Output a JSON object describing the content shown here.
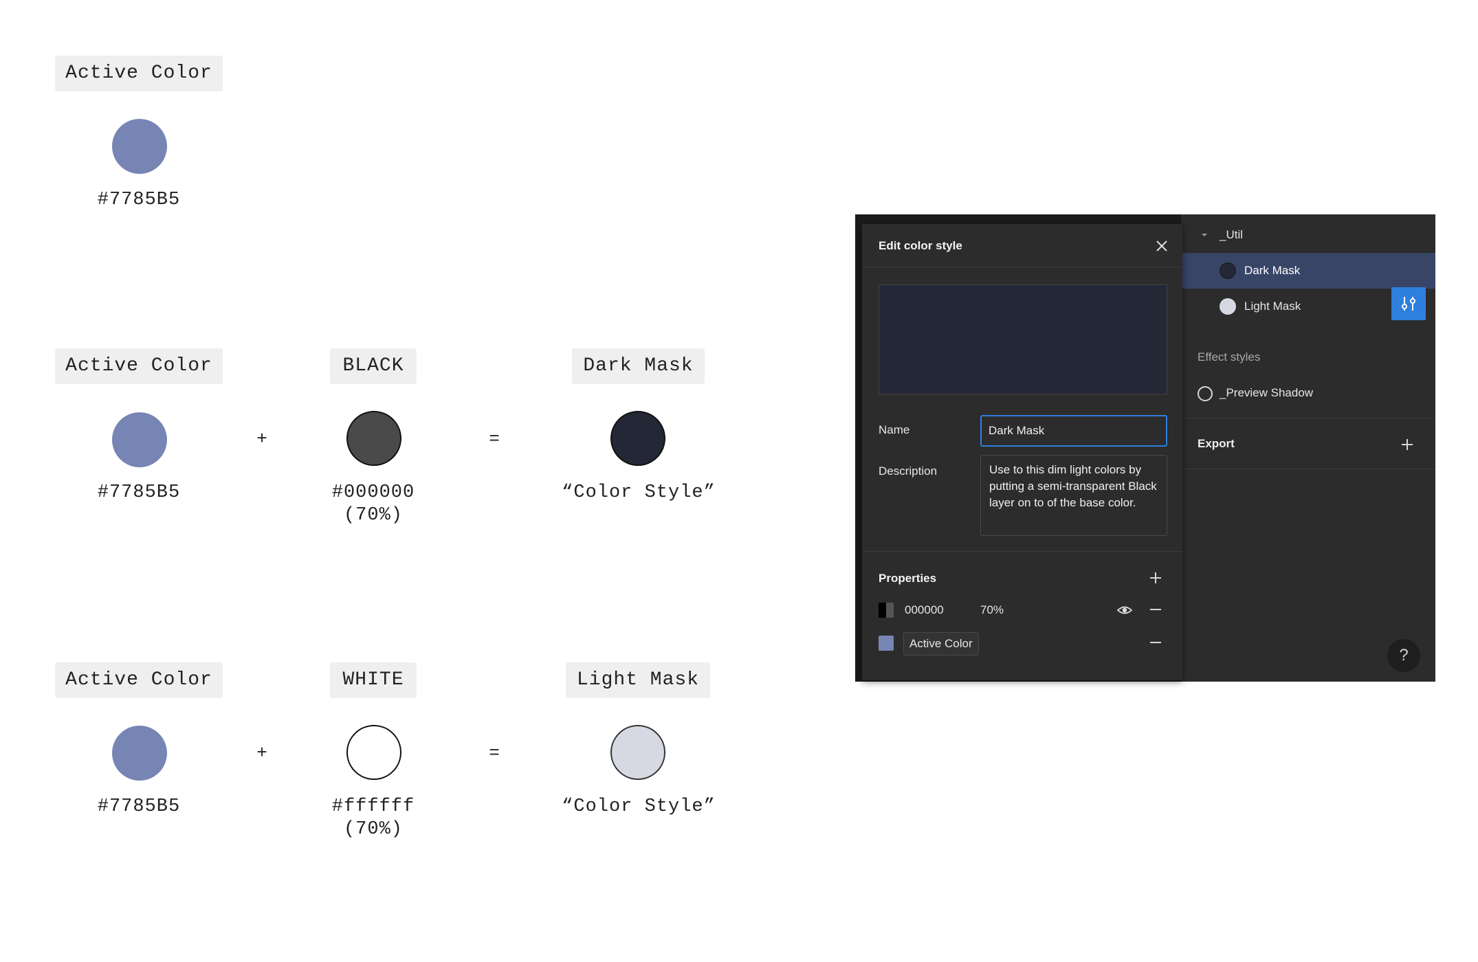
{
  "diagram": {
    "row1": {
      "base": {
        "label": "Active Color",
        "hex": "#7785B5",
        "color": "#7785B5"
      }
    },
    "row2": {
      "base": {
        "label": "Active Color",
        "hex": "#7785B5",
        "color": "#7785B5"
      },
      "plus": "+",
      "overlay": {
        "label": "BLACK",
        "hex": "#000000",
        "opacity": "(70%)",
        "color": "#4a4a4a"
      },
      "equals": "=",
      "result": {
        "label": "Dark Mask",
        "caption": "“Color Style”",
        "color": "#232736"
      }
    },
    "row3": {
      "base": {
        "label": "Active Color",
        "hex": "#7785B5",
        "color": "#7785B5"
      },
      "plus": "+",
      "overlay": {
        "label": "WHITE",
        "hex": "#ffffff",
        "opacity": "(70%)",
        "color": "#ffffff"
      },
      "equals": "=",
      "result": {
        "label": "Light Mask",
        "caption": "“Color Style”",
        "color": "#d6d9e3"
      }
    }
  },
  "modal": {
    "title": "Edit color style",
    "preview_color": "#232736",
    "name_label": "Name",
    "name_value": "Dark Mask",
    "description_label": "Description",
    "description_value": "Use to this dim light colors by putting a semi-transparent Black layer on to of the base color.",
    "properties_label": "Properties",
    "fills": [
      {
        "hex": "000000",
        "opacity": "70%"
      },
      {
        "style_name": "Active Color",
        "color": "#7785B5"
      }
    ]
  },
  "sidebar": {
    "group": "_Util",
    "items": [
      {
        "label": "Dark Mask",
        "color": "#232736",
        "selected": true
      },
      {
        "label": "Light Mask",
        "color": "#d6d9e3",
        "selected": false
      }
    ],
    "effect_styles_label": "Effect styles",
    "effect_item": "_Preview Shadow",
    "export_label": "Export",
    "help": "?"
  },
  "icons": [
    "close-icon",
    "plus-icon",
    "minus-icon",
    "eye-icon",
    "caret-down-icon",
    "adjust-style-icon",
    "effect-ring-icon",
    "help-icon"
  ],
  "colors": {
    "accent": "#2f7fde",
    "selection": "#384566",
    "panel": "#2c2c2c"
  }
}
